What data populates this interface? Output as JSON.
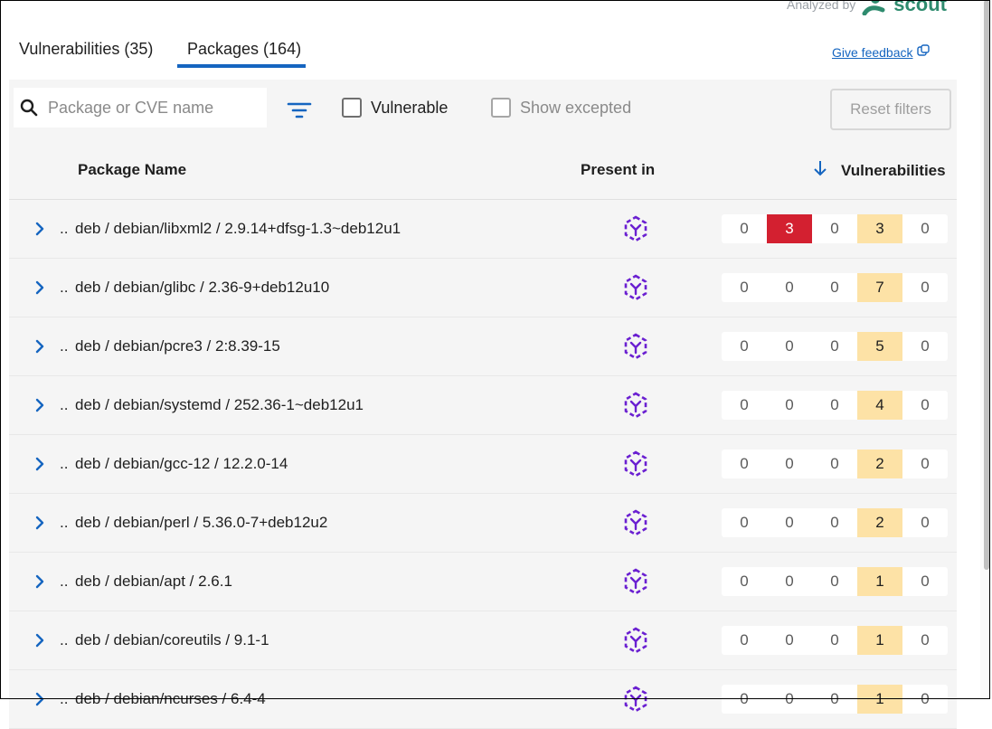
{
  "brand": {
    "prefix": "Analyzed by",
    "name": "scout"
  },
  "tabs": [
    {
      "label": "Vulnerabilities (35)",
      "active": false
    },
    {
      "label": "Packages (164)",
      "active": true
    }
  ],
  "feedback": {
    "label": "Give feedback"
  },
  "filters": {
    "search_placeholder": "Package or CVE name",
    "search_value": "",
    "vulnerable_label": "Vulnerable",
    "vulnerable_checked": false,
    "show_excepted_label": "Show excepted",
    "show_excepted_checked": false,
    "reset_label": "Reset filters"
  },
  "table": {
    "columns": {
      "name": "Package Name",
      "present": "Present in",
      "vulnerabilities": "Vulnerabilities"
    },
    "sort": "descending",
    "rows": [
      {
        "prefix": "..",
        "name": "deb / debian/libxml2 / 2.9.14+dfsg-1.3~deb12u1",
        "counts": [
          "0",
          "3",
          "0",
          "3",
          "0"
        ]
      },
      {
        "prefix": "..",
        "name": "deb / debian/glibc / 2.36-9+deb12u10",
        "counts": [
          "0",
          "0",
          "0",
          "7",
          "0"
        ]
      },
      {
        "prefix": "..",
        "name": "deb / debian/pcre3 / 2:8.39-15",
        "counts": [
          "0",
          "0",
          "0",
          "5",
          "0"
        ]
      },
      {
        "prefix": "..",
        "name": "deb / debian/systemd / 252.36-1~deb12u1",
        "counts": [
          "0",
          "0",
          "0",
          "4",
          "0"
        ]
      },
      {
        "prefix": "..",
        "name": "deb / debian/gcc-12 / 12.2.0-14",
        "counts": [
          "0",
          "0",
          "0",
          "2",
          "0"
        ]
      },
      {
        "prefix": "..",
        "name": "deb / debian/perl / 5.36.0-7+deb12u2",
        "counts": [
          "0",
          "0",
          "0",
          "2",
          "0"
        ]
      },
      {
        "prefix": "..",
        "name": "deb / debian/apt / 2.6.1",
        "counts": [
          "0",
          "0",
          "0",
          "1",
          "0"
        ]
      },
      {
        "prefix": "..",
        "name": "deb / debian/coreutils / 9.1-1",
        "counts": [
          "0",
          "0",
          "0",
          "1",
          "0"
        ]
      },
      {
        "prefix": "..",
        "name": "deb / debian/ncurses / 6.4-4",
        "counts": [
          "0",
          "0",
          "0",
          "1",
          "0"
        ]
      }
    ]
  },
  "colors": {
    "accent": "#1565c0",
    "critical": "#d32030",
    "medium": "#fde2a6",
    "layer_icon": "#6a1fd1",
    "brand": "#2e8b6e"
  }
}
